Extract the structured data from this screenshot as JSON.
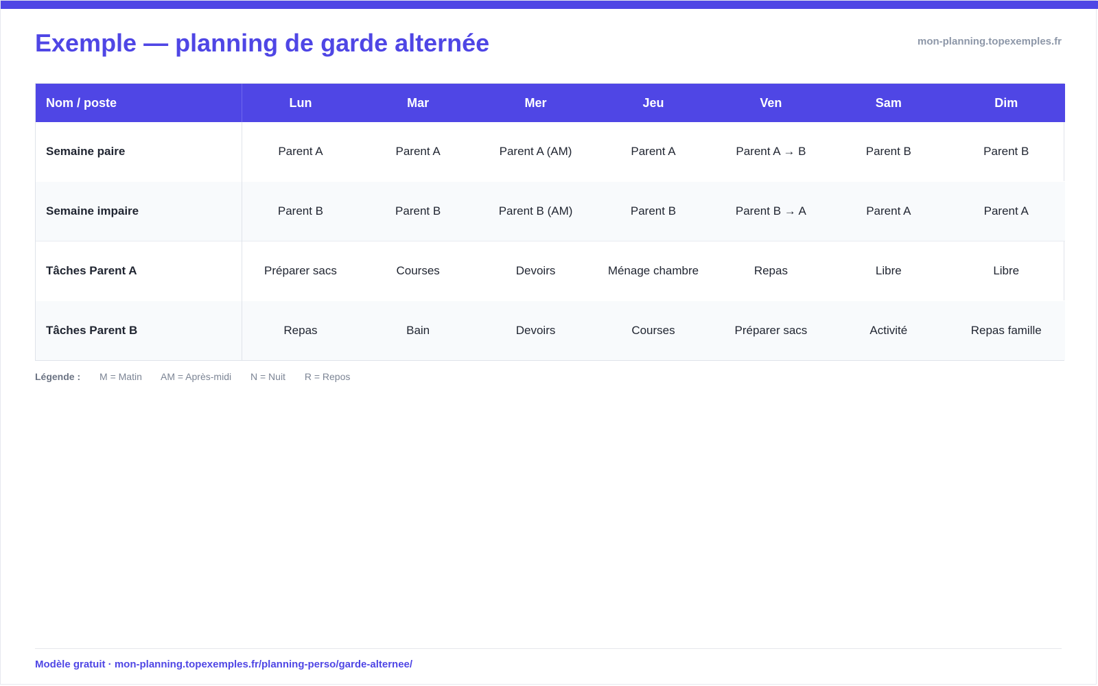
{
  "header": {
    "title": "Exemple — planning de garde alternée",
    "site": "mon-planning.topexemples.fr"
  },
  "table": {
    "columns": [
      "Nom / poste",
      "Lun",
      "Mar",
      "Mer",
      "Jeu",
      "Ven",
      "Sam",
      "Dim"
    ],
    "rows": [
      {
        "label": "Semaine paire",
        "cells": [
          "Parent A",
          "Parent A",
          "Parent A (AM)",
          "Parent A",
          "Parent A → B",
          "Parent B",
          "Parent B"
        ]
      },
      {
        "label": "Semaine impaire",
        "cells": [
          "Parent B",
          "Parent B",
          "Parent B (AM)",
          "Parent B",
          "Parent B → A",
          "Parent A",
          "Parent A"
        ]
      },
      {
        "label": "Tâches Parent A",
        "cells": [
          "Préparer sacs",
          "Courses",
          "Devoirs",
          "Ménage chambre",
          "Repas",
          "Libre",
          "Libre"
        ]
      },
      {
        "label": "Tâches Parent B",
        "cells": [
          "Repas",
          "Bain",
          "Devoirs",
          "Courses",
          "Préparer sacs",
          "Activité",
          "Repas famille"
        ]
      }
    ]
  },
  "legend": {
    "title": "Légende :",
    "items": [
      "M = Matin",
      "AM = Après-midi",
      "N = Nuit",
      "R = Repos"
    ]
  },
  "footer": {
    "text": "Modèle gratuit · mon-planning.topexemples.fr/planning-perso/garde-alternee/"
  },
  "colors": {
    "accent": "#4f46e5",
    "muted": "#8d97a8",
    "text": "#1f2430",
    "row_alt": "#f8fafc"
  }
}
